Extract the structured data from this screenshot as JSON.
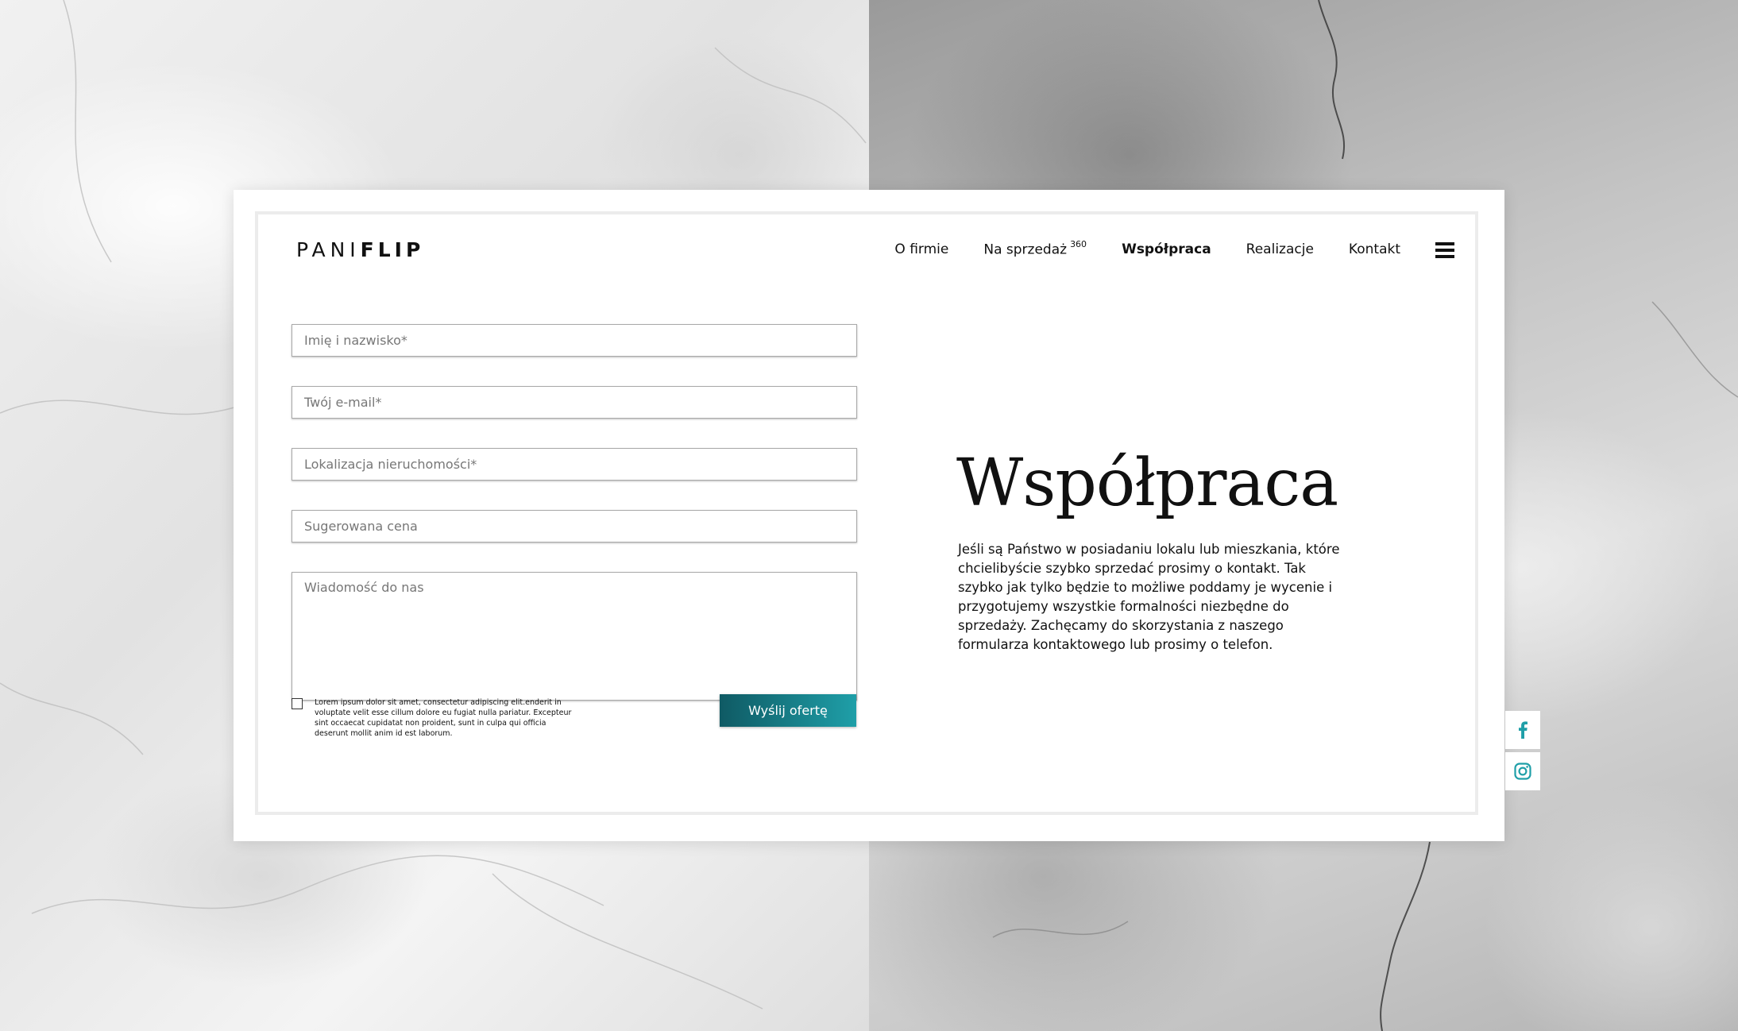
{
  "logo": {
    "part1": "PANI",
    "part2": "FLIP"
  },
  "nav": {
    "items": [
      {
        "label": "O firmie"
      },
      {
        "label": "Na sprzedaż",
        "sup": "360"
      },
      {
        "label": "Współpraca"
      },
      {
        "label": "Realizacje"
      },
      {
        "label": "Kontakt"
      }
    ],
    "menu_icon": "hamburger-menu-icon"
  },
  "form": {
    "name_placeholder": "Imię i nazwisko*",
    "email_placeholder": "Twój e-mail*",
    "location_placeholder": "Lokalizacja nieruchomości*",
    "price_placeholder": "Sugerowana cena",
    "message_placeholder": "Wiadomość do nas",
    "consent_text": "Lorem ipsum dolor sit amet, consectetur adipiscing elit.enderit in voluptate velit esse cillum dolore eu fugiat nulla pariatur. Excepteur sint occaecat cupidatat non proident, sunt in culpa qui officia deserunt mollit anim id est laborum.",
    "submit_label": "Wyślij ofertę"
  },
  "content": {
    "heading": "Współpraca",
    "paragraph": "Jeśli są Państwo w posiadaniu lokalu lub mieszkania, które chcielibyście szybko sprzedać prosimy o kontakt. Tak szybko jak tylko będzie to możliwe poddamy je wycenie i przygotujemy wszystkie formalności niezbędne do sprzedaży. Zachęcamy do skorzystania z naszego formularza kontaktowego lub prosimy o telefon."
  },
  "social": {
    "facebook_icon": "facebook-icon",
    "instagram_icon": "instagram-icon",
    "icon_color": "#1f9fa8"
  },
  "colors": {
    "accent_dark": "#0f5a64",
    "accent_light": "#1f9fa8",
    "text": "#111111"
  }
}
